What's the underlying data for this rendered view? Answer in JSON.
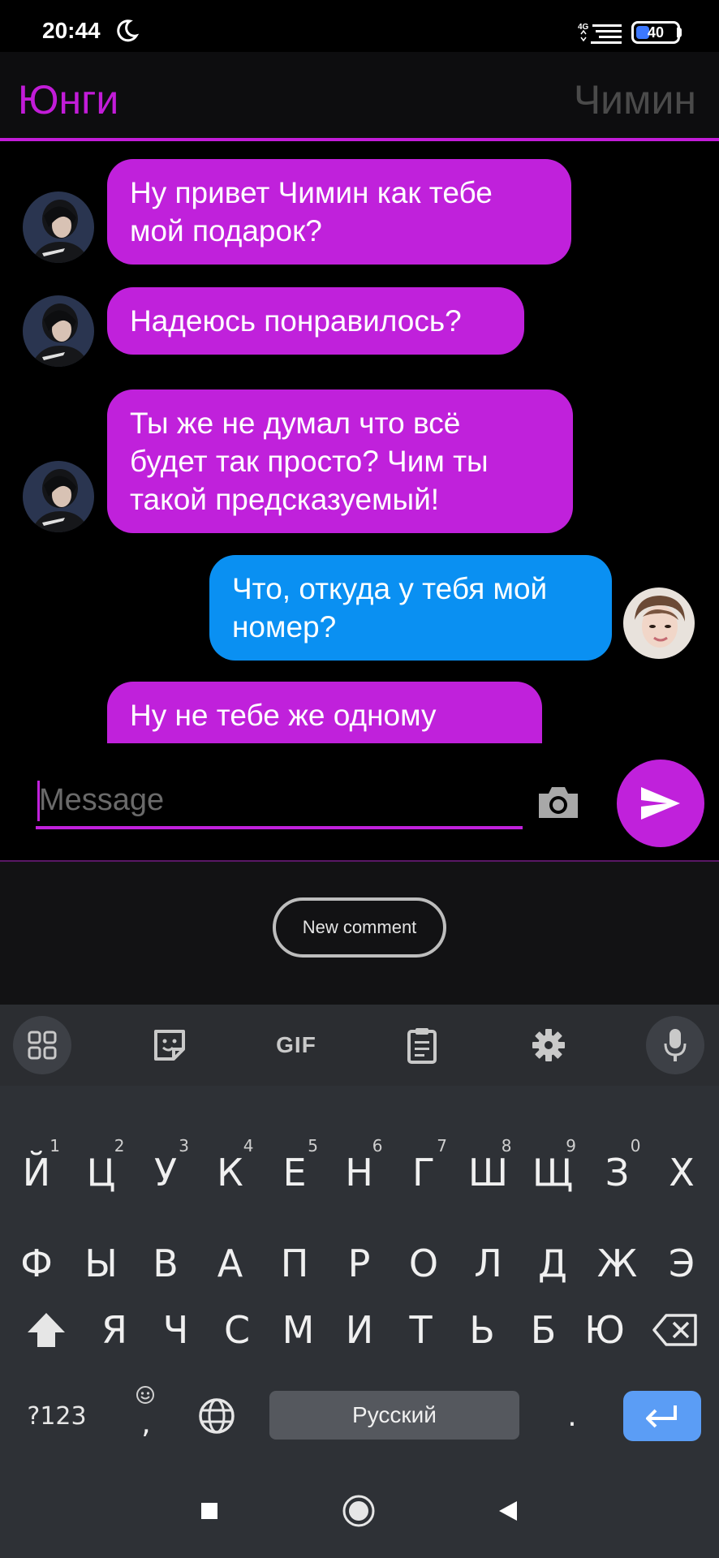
{
  "status_bar": {
    "time": "20:44",
    "network": "4G",
    "battery": "40",
    "battery_level_percent": 40
  },
  "header": {
    "left_name": "Юнги",
    "right_name": "Чимин",
    "accent_color": "#c21cd8"
  },
  "messages": [
    {
      "sender": "left",
      "text_lines": [
        "Ну привет Чимин как тебе",
        "мой подарок?"
      ],
      "bubble_color": "#c021db"
    },
    {
      "sender": "left",
      "text_lines": [
        "Надеюсь понравилось?"
      ],
      "bubble_color": "#c021db"
    },
    {
      "sender": "left",
      "text_lines": [
        "Ты же не думал что всё",
        "будет так просто?  Чим ты",
        "такой предсказуемый!"
      ],
      "bubble_color": "#c021db"
    },
    {
      "sender": "right",
      "text_lines": [
        "Что, откуда у тебя мой",
        "номер?"
      ],
      "bubble_color": "#0a90f2"
    },
    {
      "sender": "left",
      "text_lines": [
        "Ну не тебе же одному"
      ],
      "bubble_color": "#c021db"
    }
  ],
  "input": {
    "placeholder": "Message",
    "value": ""
  },
  "comment": {
    "button_label": "New comment"
  },
  "keyboard": {
    "toolbar": [
      "apps-grid-icon",
      "sticker-icon",
      "GIF",
      "clipboard-icon",
      "gear-icon",
      "mic-icon"
    ],
    "gif_label": "GIF",
    "row1": [
      "Й",
      "Ц",
      "У",
      "К",
      "Е",
      "Н",
      "Г",
      "Ш",
      "Щ",
      "З",
      "Х"
    ],
    "row1_hints": [
      "1",
      "2",
      "3",
      "4",
      "5",
      "6",
      "7",
      "8",
      "9",
      "0",
      ""
    ],
    "row2": [
      "Ф",
      "Ы",
      "В",
      "А",
      "П",
      "Р",
      "О",
      "Л",
      "Д",
      "Ж",
      "Э"
    ],
    "row3": [
      "Я",
      "Ч",
      "С",
      "М",
      "И",
      "Т",
      "Ь",
      "Б",
      "Ю"
    ],
    "symbols_label": "?123",
    "comma_label": ",",
    "space_label": "Русский",
    "period_label": "."
  },
  "colors": {
    "bubble_left": "#c021db",
    "bubble_right": "#0a90f2",
    "keyboard_bg": "#2e3136",
    "enter_key": "#5b9df5"
  }
}
